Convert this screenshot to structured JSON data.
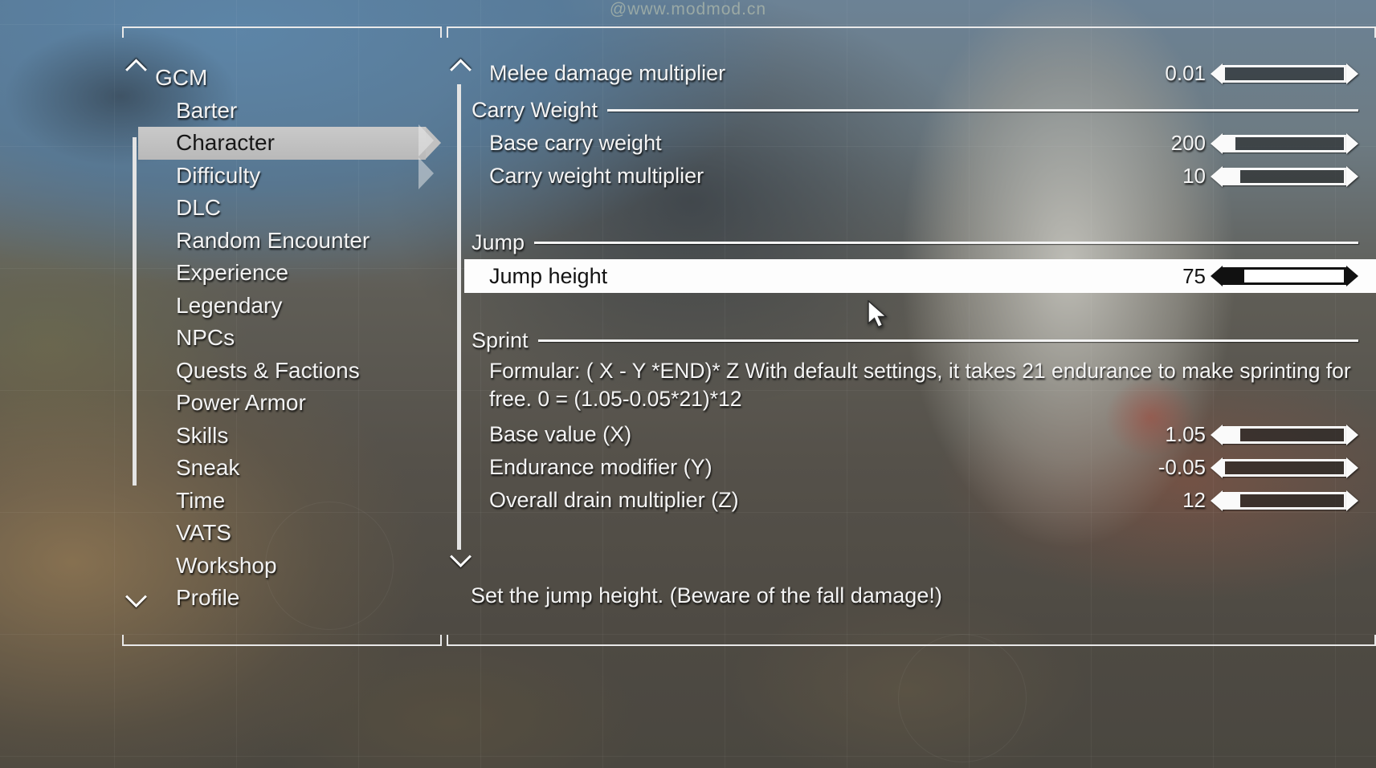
{
  "watermark": "@www.modmod.cn",
  "left_menu": {
    "scroll_up_icon": "chevron-up-icon",
    "scroll_down_icon": "chevron-down-icon",
    "items": [
      {
        "label": "GCM",
        "level": "root",
        "selected": false
      },
      {
        "label": "Barter",
        "level": "child",
        "selected": false
      },
      {
        "label": "Character",
        "level": "child",
        "selected": true
      },
      {
        "label": "Difficulty",
        "level": "child",
        "selected": false
      },
      {
        "label": "DLC",
        "level": "child",
        "selected": false
      },
      {
        "label": "Random Encounter",
        "level": "child",
        "selected": false
      },
      {
        "label": "Experience",
        "level": "child",
        "selected": false
      },
      {
        "label": "Legendary",
        "level": "child",
        "selected": false
      },
      {
        "label": "NPCs",
        "level": "child",
        "selected": false
      },
      {
        "label": "Quests & Factions",
        "level": "child",
        "selected": false
      },
      {
        "label": "Power Armor",
        "level": "child",
        "selected": false
      },
      {
        "label": "Skills",
        "level": "child",
        "selected": false
      },
      {
        "label": "Sneak",
        "level": "child",
        "selected": false
      },
      {
        "label": "Time",
        "level": "child",
        "selected": false
      },
      {
        "label": "VATS",
        "level": "child",
        "selected": false
      },
      {
        "label": "Workshop",
        "level": "child",
        "selected": false
      },
      {
        "label": "Profile",
        "level": "child",
        "selected": false
      }
    ]
  },
  "content": {
    "scroll_up_icon": "chevron-up-icon",
    "scroll_down_icon": "chevron-down-icon",
    "rows": {
      "melee_damage_multiplier": {
        "label": "Melee damage multiplier",
        "value": "0.01",
        "fill_pct": 0
      },
      "base_carry_weight": {
        "label": "Base carry weight",
        "value": "200",
        "fill_pct": 9
      },
      "carry_weight_multiplier": {
        "label": "Carry weight multiplier",
        "value": "10",
        "fill_pct": 13
      },
      "jump_height": {
        "label": "Jump height",
        "value": "75",
        "fill_pct": 16
      },
      "base_value_x": {
        "label": "Base value (X)",
        "value": "1.05",
        "fill_pct": 13
      },
      "endurance_modifier_y": {
        "label": "Endurance modifier (Y)",
        "value": "-0.05",
        "fill_pct": 0
      },
      "overall_drain_multiplier_z": {
        "label": "Overall drain multiplier (Z)",
        "value": "12",
        "fill_pct": 13
      }
    },
    "sections": {
      "carry_weight": "Carry Weight",
      "jump": "Jump",
      "sprint": "Sprint"
    },
    "sprint_description": "Formular: ( X - Y *END)* Z With default settings, it takes 21 endurance to make sprinting for free. 0 = (1.05-0.05*21)*12",
    "footer_help": "Set the jump height. (Beware of the fall damage!)"
  },
  "colors": {
    "panel_border": "#e9e9e9",
    "text": "#f4f4f4",
    "highlight_bg": "#fdfdfd",
    "highlight_text": "#131313",
    "selected_item_bg": "#c1c1c1"
  }
}
